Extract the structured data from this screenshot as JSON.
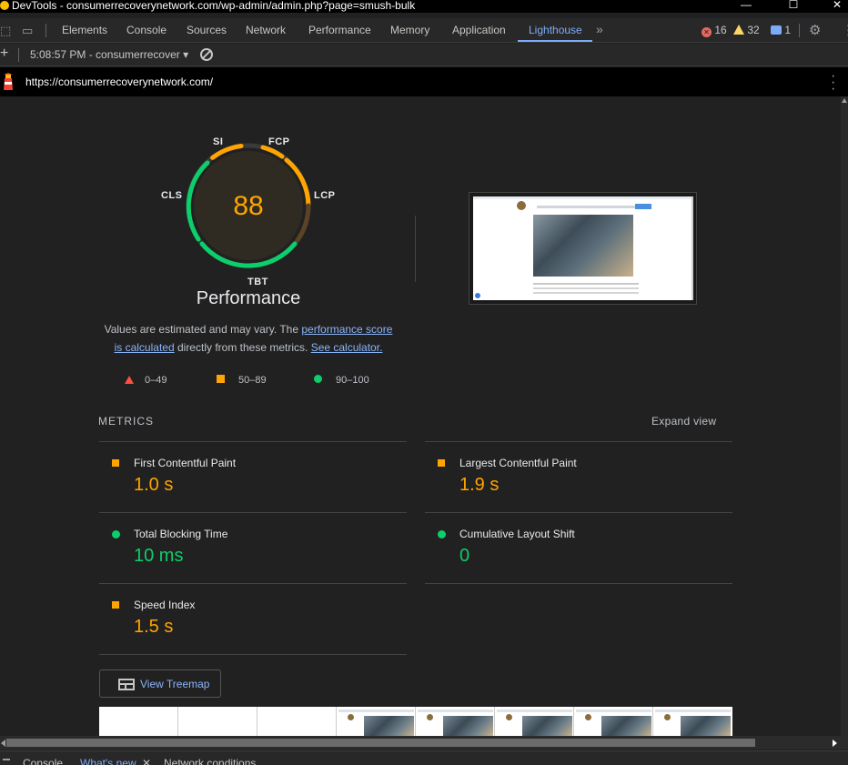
{
  "window": {
    "title": "DevTools - consumerrecoverynetwork.com/wp-admin/admin.php?page=smush-bulk",
    "minimize": "—",
    "maximize": "☐",
    "close": "✕"
  },
  "tabs": [
    {
      "label": "Elements"
    },
    {
      "label": "Console"
    },
    {
      "label": "Sources"
    },
    {
      "label": "Network"
    },
    {
      "label": "Performance"
    },
    {
      "label": "Memory"
    },
    {
      "label": "Application"
    },
    {
      "label": "Lighthouse",
      "active": true
    }
  ],
  "tabs_more": "»",
  "status": {
    "errors": "16",
    "warnings": "32",
    "messages": "1"
  },
  "toolbar": {
    "add": "+",
    "report_select": "5:08:57 PM - consumerrecover ▾"
  },
  "report": {
    "url": "https://consumerrecoverynetwork.com/",
    "score": "88",
    "category_title": "Performance",
    "gauge_labels": {
      "si": "SI",
      "fcp": "FCP",
      "lcp": "LCP",
      "tbt": "TBT",
      "cls": "CLS"
    },
    "note_prefix": "Values are estimated and may vary. The ",
    "note_link1_a": "performance score",
    "note_link1_b": "is calculated",
    "note_middle": " directly from these metrics. ",
    "note_link2": "See calculator.",
    "legend": {
      "fail": "0–49",
      "average": "50–89",
      "pass": "90–100"
    },
    "metrics_header": "METRICS",
    "expand_view": "Expand view",
    "metrics": {
      "fcp": {
        "title": "First Contentful Paint",
        "value": "1.0 s",
        "rating": "average"
      },
      "lcp": {
        "title": "Largest Contentful Paint",
        "value": "1.9 s",
        "rating": "average"
      },
      "tbt": {
        "title": "Total Blocking Time",
        "value": "10 ms",
        "rating": "pass"
      },
      "cls": {
        "title": "Cumulative Layout Shift",
        "value": "0",
        "rating": "pass"
      },
      "si": {
        "title": "Speed Index",
        "value": "1.5 s",
        "rating": "average"
      }
    },
    "treemap_button": "View Treemap"
  },
  "drawer": {
    "tabs": [
      {
        "label": "Console"
      },
      {
        "label": "What's new",
        "active": true,
        "close": "✕"
      },
      {
        "label": "Network conditions"
      }
    ]
  },
  "colors": {
    "accent": "#7cacf8",
    "average": "#ffa400",
    "pass": "#0cce6b",
    "fail": "#ff4e42",
    "link": "#8ab4f8"
  }
}
